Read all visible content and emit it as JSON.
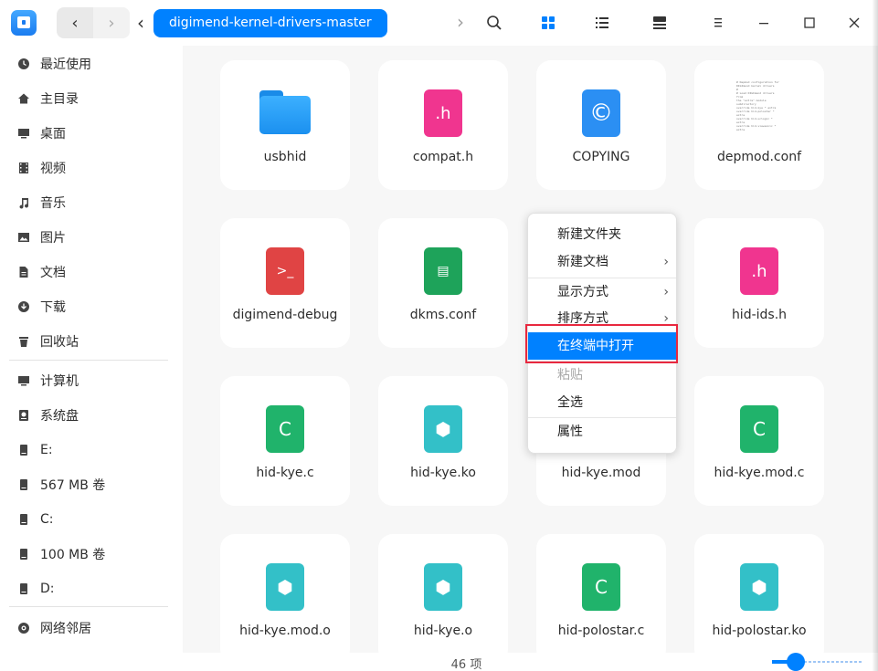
{
  "toolbar": {
    "back_icon": "chevron-left-icon",
    "back_glyph": "‹",
    "forward_glyph": "›",
    "crumb_arrow": "‹",
    "crumb_next": "›",
    "breadcrumb": "digimend-kernel-drivers-master",
    "search_glyph": "⌕",
    "menu_glyph": "☰",
    "minimize_glyph": "—",
    "close_glyph": "✕"
  },
  "sidebar": {
    "items": [
      {
        "label": "最近使用",
        "icon": "clock-icon"
      },
      {
        "label": "主目录",
        "icon": "home-icon"
      },
      {
        "label": "桌面",
        "icon": "desktop-icon"
      },
      {
        "label": "视频",
        "icon": "video-icon"
      },
      {
        "label": "音乐",
        "icon": "music-icon"
      },
      {
        "label": "图片",
        "icon": "picture-icon"
      },
      {
        "label": "文档",
        "icon": "document-icon"
      },
      {
        "label": "下载",
        "icon": "download-icon"
      },
      {
        "label": "回收站",
        "icon": "trash-icon"
      },
      {
        "label": "计算机",
        "icon": "computer-icon"
      },
      {
        "label": "系统盘",
        "icon": "system-disk-icon"
      },
      {
        "label": "E:",
        "icon": "drive-icon"
      },
      {
        "label": "567 MB 卷",
        "icon": "drive-icon"
      },
      {
        "label": "C:",
        "icon": "drive-icon"
      },
      {
        "label": "100 MB 卷",
        "icon": "drive-icon"
      },
      {
        "label": "D:",
        "icon": "drive-icon"
      },
      {
        "label": "网络邻居",
        "icon": "network-icon"
      }
    ]
  },
  "files": [
    {
      "name": "usbhid",
      "type": "folder"
    },
    {
      "name": "compat.h",
      "type": "header",
      "glyph": ".h"
    },
    {
      "name": "COPYING",
      "type": "copyright",
      "glyph": "©"
    },
    {
      "name": "depmod.conf",
      "type": "text"
    },
    {
      "name": "digimend-debug",
      "type": "script",
      "glyph": ">_"
    },
    {
      "name": "dkms.conf",
      "type": "config",
      "glyph": "▤"
    },
    {
      "name": "",
      "type": "hidden"
    },
    {
      "name": "hid-ids.h",
      "type": "header",
      "glyph": ".h"
    },
    {
      "name": "hid-kye.c",
      "type": "c",
      "glyph": "C"
    },
    {
      "name": "hid-kye.ko",
      "type": "module",
      "glyph": "⬢"
    },
    {
      "name": "hid-kye.mod",
      "type": "hidden"
    },
    {
      "name": "hid-kye.mod.c",
      "type": "c",
      "glyph": "C"
    },
    {
      "name": "hid-kye.mod.o",
      "type": "module",
      "glyph": "⬢"
    },
    {
      "name": "hid-kye.o",
      "type": "module",
      "glyph": "⬢"
    },
    {
      "name": "hid-polostar.c",
      "type": "c",
      "glyph": "C"
    },
    {
      "name": "hid-polostar.ko",
      "type": "module",
      "glyph": "⬢"
    }
  ],
  "depmod_preview": "# Depmod configuration for\nDIGImend kernel drivers\n#\n# Load DIGImend drivers from\nthe \"extra\" module subdirectory\noverride hid-kye * extra\noverride hid-polostar * extra\noverride hid-uclogic * extra\noverride hid-viewsonic * extra",
  "context_menu": {
    "items": [
      {
        "label": "新建文件夹",
        "submenu": false,
        "state": "normal"
      },
      {
        "label": "新建文档",
        "submenu": true,
        "state": "normal"
      },
      {
        "label": "显示方式",
        "submenu": true,
        "state": "normal"
      },
      {
        "label": "排序方式",
        "submenu": true,
        "state": "normal"
      },
      {
        "label": "在终端中打开",
        "submenu": false,
        "state": "active"
      },
      {
        "label": "粘贴",
        "submenu": false,
        "state": "disabled"
      },
      {
        "label": "全选",
        "submenu": false,
        "state": "normal"
      },
      {
        "label": "属性",
        "submenu": false,
        "state": "normal"
      }
    ],
    "submenu_glyph": "›"
  },
  "status": {
    "item_count": "46 项",
    "zoom_level": 0.25
  },
  "colors": {
    "accent": "#0081ff",
    "header_icon": "#f0358f",
    "copyright_icon": "#2b8ff3",
    "script_icon": "#e04444",
    "config_icon": "#1ea35a",
    "c_icon": "#20b36b",
    "module_icon": "#33c0c8",
    "highlight_border": "#e8283f"
  }
}
